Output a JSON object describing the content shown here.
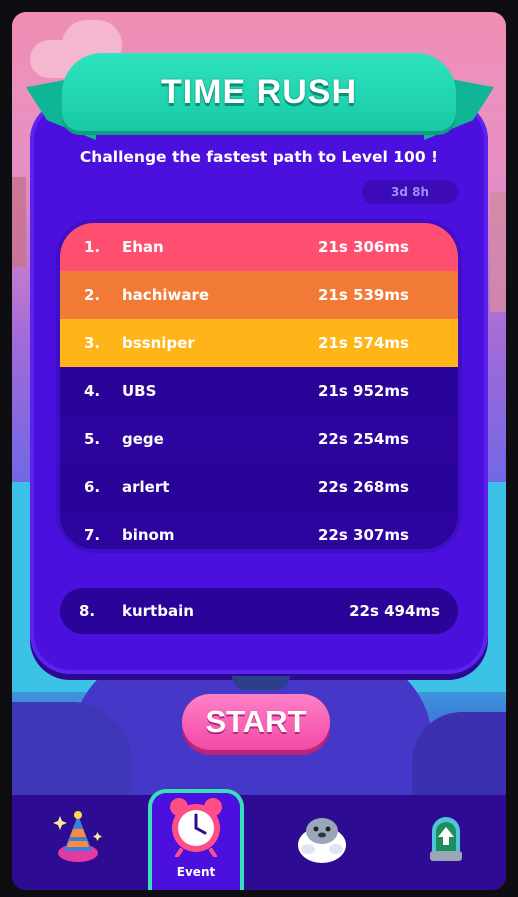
{
  "event": {
    "title": "TIME RUSH",
    "subtitle": "Challenge the fastest path to Level 100 !",
    "timer": "3d 8h"
  },
  "leaderboard": [
    {
      "rank": "1.",
      "name": "Ehan",
      "time": "21s 306ms",
      "color": "#ff4f71"
    },
    {
      "rank": "2.",
      "name": "hachiware",
      "time": "21s 539ms",
      "color": "#f27a37"
    },
    {
      "rank": "3.",
      "name": "bssniper",
      "time": "21s 574ms",
      "color": "#ffb418"
    },
    {
      "rank": "4.",
      "name": "UBS",
      "time": "21s 952ms",
      "color": "#2a0398"
    },
    {
      "rank": "5.",
      "name": "gege",
      "time": "22s 254ms",
      "color": "#2d059e"
    },
    {
      "rank": "6.",
      "name": "arlert",
      "time": "22s 268ms",
      "color": "#2a0398"
    },
    {
      "rank": "7.",
      "name": "binom",
      "time": "22s 307ms",
      "color": "#2d059e"
    }
  ],
  "my_entry": {
    "rank": "8.",
    "name": "kurtbain",
    "time": "22s 494ms"
  },
  "start_label": "START",
  "nav": {
    "items": [
      {
        "id": "party",
        "icon": "party-hat-icon",
        "label": ""
      },
      {
        "id": "event",
        "icon": "alarm-clock-icon",
        "label": "Event",
        "active": true
      },
      {
        "id": "pet",
        "icon": "seal-mascot-icon",
        "label": ""
      },
      {
        "id": "upgrade",
        "icon": "upgrade-arrow-icon",
        "label": ""
      }
    ]
  },
  "colors": {
    "panel": "#4b10de",
    "ribbon": "#1fd3b0",
    "start_button": "#f24aa6",
    "navbar": "#2d0c93",
    "active_tab_border": "#36e0b8"
  }
}
